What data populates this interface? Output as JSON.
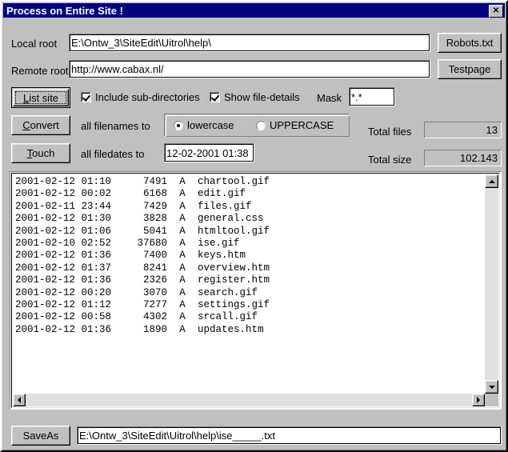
{
  "window": {
    "title": "Process on Entire Site !",
    "close_label": "✕",
    "titlebar_color": "#000080",
    "face_color": "#c0c0c0"
  },
  "form": {
    "local_root_label": "Local root",
    "local_root_value": "E:\\Ontw_3\\SiteEdit\\Uitrol\\help\\",
    "remote_root_label": "Remote root",
    "remote_root_value": "http://www.cabax.nl/",
    "robots_button": "Robots.txt",
    "testpage_button": "Testpage"
  },
  "actions": {
    "list_site_button": "List site",
    "list_site_accel": "L",
    "convert_button": "Convert",
    "convert_accel": "C",
    "touch_button": "Touch",
    "touch_accel": "T",
    "saveas_button": "SaveAs"
  },
  "options": {
    "include_subdirs_label": "Include sub-directories",
    "include_subdirs_checked": true,
    "show_file_details_label": "Show file-details",
    "show_file_details_checked": true,
    "mask_label": "Mask",
    "mask_value": "*.*"
  },
  "convert_row": {
    "description": "all filenames to",
    "radio_lowercase": "lowercase",
    "radio_uppercase": "UPPERCASE",
    "selected": "lowercase"
  },
  "touch_row": {
    "description": "all filedates to",
    "date_value": "12-02-2001 01:38"
  },
  "totals": {
    "files_label": "Total files",
    "files_value": "13",
    "size_label": "Total size",
    "size_value": "102.143"
  },
  "saveas": {
    "path_value": "E:\\Ontw_3\\SiteEdit\\Uitrol\\help\\ise_____.txt"
  },
  "filelist": {
    "rows": [
      {
        "date": "2001-02-12 01:10",
        "size": "7491",
        "attr": "A",
        "name": "chartool.gif"
      },
      {
        "date": "2001-02-12 00:02",
        "size": "6168",
        "attr": "A",
        "name": "edit.gif"
      },
      {
        "date": "2001-02-11 23:44",
        "size": "7429",
        "attr": "A",
        "name": "files.gif"
      },
      {
        "date": "2001-02-12 01:30",
        "size": "3828",
        "attr": "A",
        "name": "general.css"
      },
      {
        "date": "2001-02-12 01:06",
        "size": "5041",
        "attr": "A",
        "name": "htmltool.gif"
      },
      {
        "date": "2001-02-10 02:52",
        "size": "37680",
        "attr": "A",
        "name": "ise.gif"
      },
      {
        "date": "2001-02-12 01:36",
        "size": "7400",
        "attr": "A",
        "name": "keys.htm"
      },
      {
        "date": "2001-02-12 01:37",
        "size": "8241",
        "attr": "A",
        "name": "overview.htm"
      },
      {
        "date": "2001-02-12 01:36",
        "size": "2326",
        "attr": "A",
        "name": "register.htm"
      },
      {
        "date": "2001-02-12 00:20",
        "size": "3070",
        "attr": "A",
        "name": "search.gif"
      },
      {
        "date": "2001-02-12 01:12",
        "size": "7277",
        "attr": "A",
        "name": "settings.gif"
      },
      {
        "date": "2001-02-12 00:58",
        "size": "4302",
        "attr": "A",
        "name": "srcall.gif"
      },
      {
        "date": "2001-02-12 01:36",
        "size": "1890",
        "attr": "A",
        "name": "updates.htm"
      }
    ]
  },
  "scrollbars": {
    "up_icon": "arrow-up-icon",
    "down_icon": "arrow-down-icon",
    "left_icon": "arrow-left-icon",
    "right_icon": "arrow-right-icon"
  }
}
